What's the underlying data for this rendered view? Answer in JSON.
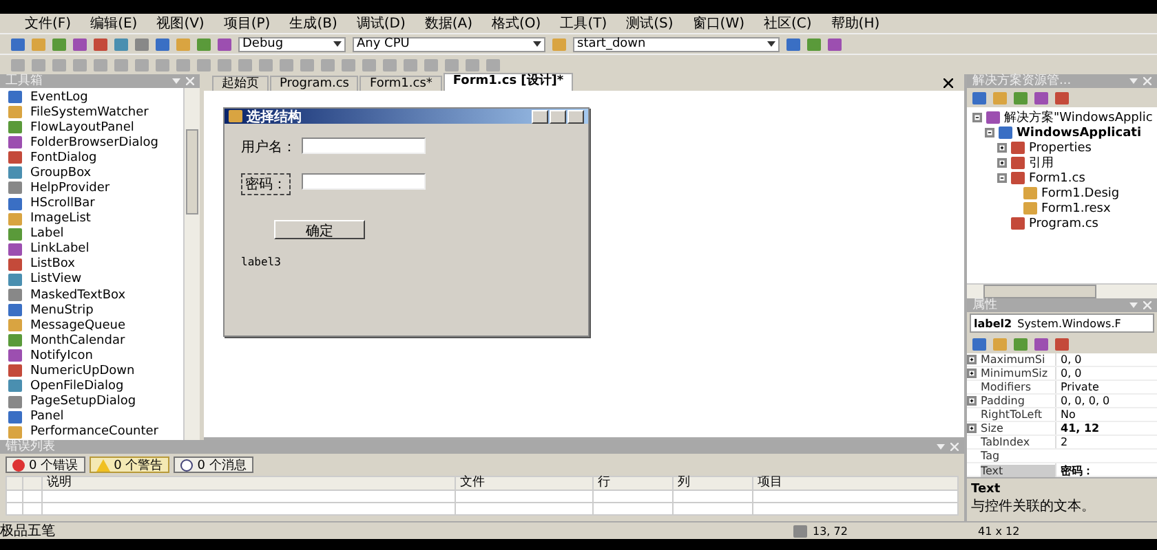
{
  "menu": [
    "文件(F)",
    "编辑(E)",
    "视图(V)",
    "项目(P)",
    "生成(B)",
    "调试(D)",
    "数据(A)",
    "格式(O)",
    "工具(T)",
    "测试(S)",
    "窗口(W)",
    "社区(C)",
    "帮助(H)"
  ],
  "toolbar": {
    "configuration": "Debug",
    "platform": "Any CPU",
    "find": "start_down"
  },
  "toolbox": {
    "title": "工具箱",
    "items": [
      "EventLog",
      "FileSystemWatcher",
      "FlowLayoutPanel",
      "FolderBrowserDialog",
      "FontDialog",
      "GroupBox",
      "HelpProvider",
      "HScrollBar",
      "ImageList",
      "Label",
      "LinkLabel",
      "ListBox",
      "ListView",
      "MaskedTextBox",
      "MenuStrip",
      "MessageQueue",
      "MonthCalendar",
      "NotifyIcon",
      "NumericUpDown",
      "OpenFileDialog",
      "PageSetupDialog",
      "Panel",
      "PerformanceCounter"
    ]
  },
  "editor_tabs": [
    {
      "label": "起始页",
      "selected": false
    },
    {
      "label": "Program.cs",
      "selected": false
    },
    {
      "label": "Form1.cs*",
      "selected": false
    },
    {
      "label": "Form1.cs [设计]*",
      "selected": true
    }
  ],
  "form": {
    "title": "选择结构",
    "controls": [
      {
        "kind": "label",
        "text": "用户名：",
        "selected": false
      },
      {
        "kind": "textbox"
      },
      {
        "kind": "label",
        "text": "密码：",
        "selected": true
      },
      {
        "kind": "textbox"
      },
      {
        "kind": "button",
        "text": "确定"
      },
      {
        "kind": "label",
        "text": "label3",
        "selected": false
      }
    ]
  },
  "solution_explorer": {
    "title": "解决方案资源管...",
    "tree": [
      {
        "label": "解决方案\"WindowsApplic",
        "bold": false,
        "expanded": true,
        "children": [
          {
            "label": "WindowsApplicati",
            "bold": true,
            "expanded": true,
            "children": [
              {
                "label": "Properties",
                "bold": false,
                "expanded": false
              },
              {
                "label": "引用",
                "bold": false,
                "expanded": false
              },
              {
                "label": "Form1.cs",
                "bold": false,
                "expanded": true,
                "children": [
                  {
                    "label": "Form1.Desig",
                    "bold": false
                  },
                  {
                    "label": "Form1.resx",
                    "bold": false
                  }
                ]
              },
              {
                "label": "Program.cs",
                "bold": false
              }
            ]
          }
        ]
      }
    ]
  },
  "properties": {
    "title": "属性",
    "object": "label2",
    "object_type": "System.Windows.F",
    "rows": [
      {
        "name": "MaximumSi",
        "value": "0, 0",
        "expandable": true,
        "modified": false,
        "selected": false
      },
      {
        "name": "MinimumSiz",
        "value": "0, 0",
        "expandable": true,
        "modified": false,
        "selected": false
      },
      {
        "name": "Modifiers",
        "value": "Private",
        "expandable": false,
        "modified": false,
        "selected": false
      },
      {
        "name": "Padding",
        "value": "0, 0, 0, 0",
        "expandable": true,
        "modified": false,
        "selected": false
      },
      {
        "name": "RightToLeft",
        "value": "No",
        "expandable": false,
        "modified": false,
        "selected": false
      },
      {
        "name": "Size",
        "value": "41, 12",
        "expandable": true,
        "modified": true,
        "selected": false
      },
      {
        "name": "TabIndex",
        "value": "2",
        "expandable": false,
        "modified": false,
        "selected": false
      },
      {
        "name": "Tag",
        "expandable": false,
        "modified": false,
        "selected": false
      },
      {
        "name": "Text",
        "value": "密码：",
        "expandable": false,
        "modified": true,
        "selected": true
      }
    ],
    "description_title": "Text",
    "description": "与控件关联的文本。"
  },
  "error_list": {
    "title": "错误列表",
    "filters": [
      {
        "label": "0 个错误",
        "kind": "error",
        "selected": false
      },
      {
        "label": "0 个警告",
        "kind": "warning",
        "selected": true
      },
      {
        "label": "0 个消息",
        "kind": "info",
        "selected": false
      }
    ],
    "columns": [
      "",
      "",
      "说明",
      "文件",
      "行",
      "列",
      "项目"
    ]
  },
  "status_bar": {
    "ime": "极品五笔",
    "position": "13, 72",
    "size": "41 x 12"
  }
}
